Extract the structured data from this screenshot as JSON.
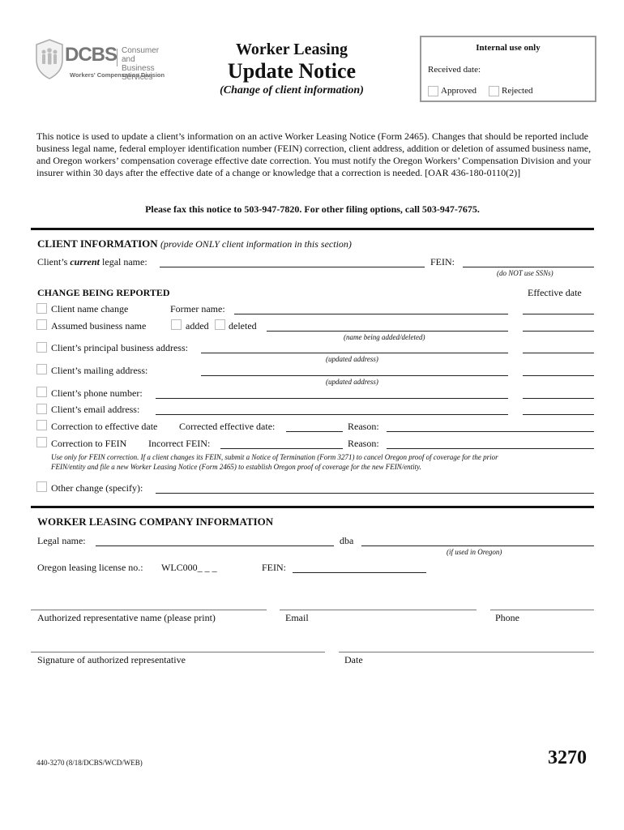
{
  "logo": {
    "acronym": "DCBS",
    "org_line1": "Consumer and",
    "org_line2": "Business Services",
    "division": "Workers' Compensation Division",
    "icon": "shield-people-icon"
  },
  "header": {
    "title_line1": "Worker Leasing",
    "title_line2": "Update Notice",
    "subtitle": "(Change of client information)"
  },
  "internal_box": {
    "heading": "Internal use only",
    "received_date_label": "Received date:",
    "approved_label": "Approved",
    "rejected_label": "Rejected"
  },
  "intro": {
    "paragraph": "This notice is used to update a client’s information on an active Worker Leasing Notice (Form 2465). Changes that should be reported include business legal name, federal employer identification number (FEIN) correction, client address, addition or deletion of assumed business name, and Oregon workers’ compensation coverage effective date correction. You must notify the Oregon Workers’ Compensation Division and your insurer within 30 days after the effective date of a change or knowledge that a correction is needed. [OAR 436-180-0110(2)]",
    "fax_line": "Please fax this notice to 503-947-7820. For other filing options, call 503-947-7675."
  },
  "client_info": {
    "heading": "CLIENT INFORMATION",
    "heading_note": "(provide ONLY client information in this section)",
    "legal_name_prefix": "Client’s ",
    "legal_name_emph": "current",
    "legal_name_suffix": " legal name:",
    "fein_label": "FEIN:",
    "fein_hint": "(do NOT use SSNs)"
  },
  "changes": {
    "heading": "CHANGE BEING REPORTED",
    "effective_date_label": "Effective date",
    "name_change": "Client name change",
    "former_name": "Former name:",
    "assumed_name": "Assumed business name",
    "added": "added",
    "deleted": "deleted",
    "assumed_hint": "(name being added/deleted)",
    "principal_address": "Client’s principal business address:",
    "updated_address_hint": "(updated address)",
    "mailing_address": "Client’s mailing address:",
    "mailing_hint": "(updated address)",
    "phone": "Client’s phone number:",
    "email": "Client’s email address:",
    "correction_date": "Correction to effective date",
    "corrected_date_label": "Corrected effective date:",
    "reason_label": "Reason:",
    "correction_fein": "Correction to FEIN",
    "incorrect_fein_label": "Incorrect FEIN:",
    "reason_label_2": "Reason:",
    "fein_note_line1": "Use only for FEIN correction. If a client changes its FEIN, submit a Notice of Termination (Form 3271) to cancel Oregon proof of coverage for the prior",
    "fein_note_line2": "FEIN/entity and file a new Worker Leasing Notice (Form 2465) to establish Oregon proof of coverage for the new FEIN/entity.",
    "other": "Other change (specify):"
  },
  "company": {
    "heading": "WORKER LEASING COMPANY INFORMATION",
    "legal_name": "Legal name:",
    "dba": "dba",
    "dba_hint": "(if used in Oregon)",
    "license_label": "Oregon leasing license no.:",
    "license_value": "WLC000_ _ _",
    "fein_label": "FEIN:"
  },
  "signature": {
    "rep_name": "Authorized representative name (please print)",
    "email": "Email",
    "phone": "Phone",
    "signature": "Signature of authorized representative",
    "date": "Date"
  },
  "footer": {
    "form_code": "440-3270 (8/18/DCBS/WCD/WEB)",
    "form_number": "3270"
  }
}
